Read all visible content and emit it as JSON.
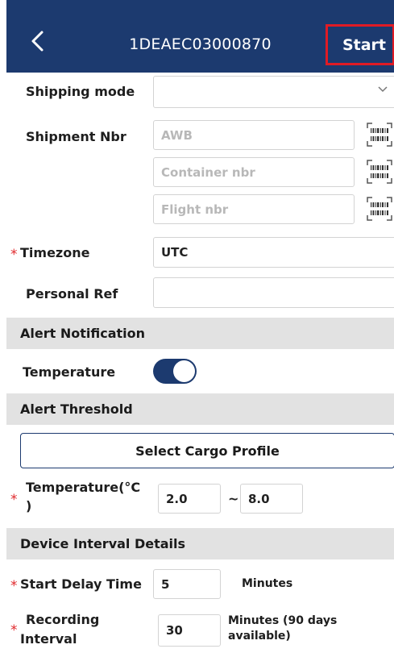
{
  "header": {
    "title": "1DEAEC03000870",
    "start_label": "Start",
    "back_icon": "chevron-left-icon"
  },
  "form": {
    "shipping_mode": {
      "label": "Shipping mode",
      "value": ""
    },
    "shipment_nbr": {
      "label": "Shipment Nbr",
      "awb_placeholder": "AWB",
      "container_placeholder": "Container nbr",
      "flight_placeholder": "Flight nbr"
    },
    "timezone": {
      "required": "*",
      "label": "Timezone",
      "value": "UTC"
    },
    "personal_ref": {
      "label": "Personal Ref",
      "value": ""
    }
  },
  "alert_notification": {
    "section": "Alert Notification",
    "temperature_label": "Temperature",
    "temperature_enabled": true
  },
  "alert_threshold": {
    "section": "Alert Threshold",
    "cargo_button": "Select Cargo Profile",
    "temp_required": "*",
    "temp_label_line1": "Temperature(°C",
    "temp_label_line2": ")",
    "min": "2.0",
    "separator": "~",
    "max": "8.0"
  },
  "device_interval": {
    "section": "Device Interval Details",
    "start_delay": {
      "required": "*",
      "label": "Start Delay Time",
      "value": "5",
      "unit": "Minutes"
    },
    "recording": {
      "required": "*",
      "label_line1": "Recording",
      "label_line2": "Interval",
      "value": "30",
      "unit_line1": "Minutes (90 days",
      "unit_line2": "available)"
    }
  },
  "colors": {
    "header_bg": "#1c3a6f",
    "accent": "#1c3a6f",
    "required": "#e0282b",
    "section_bg": "#e2e2e2",
    "highlight_border": "#e01b24"
  }
}
